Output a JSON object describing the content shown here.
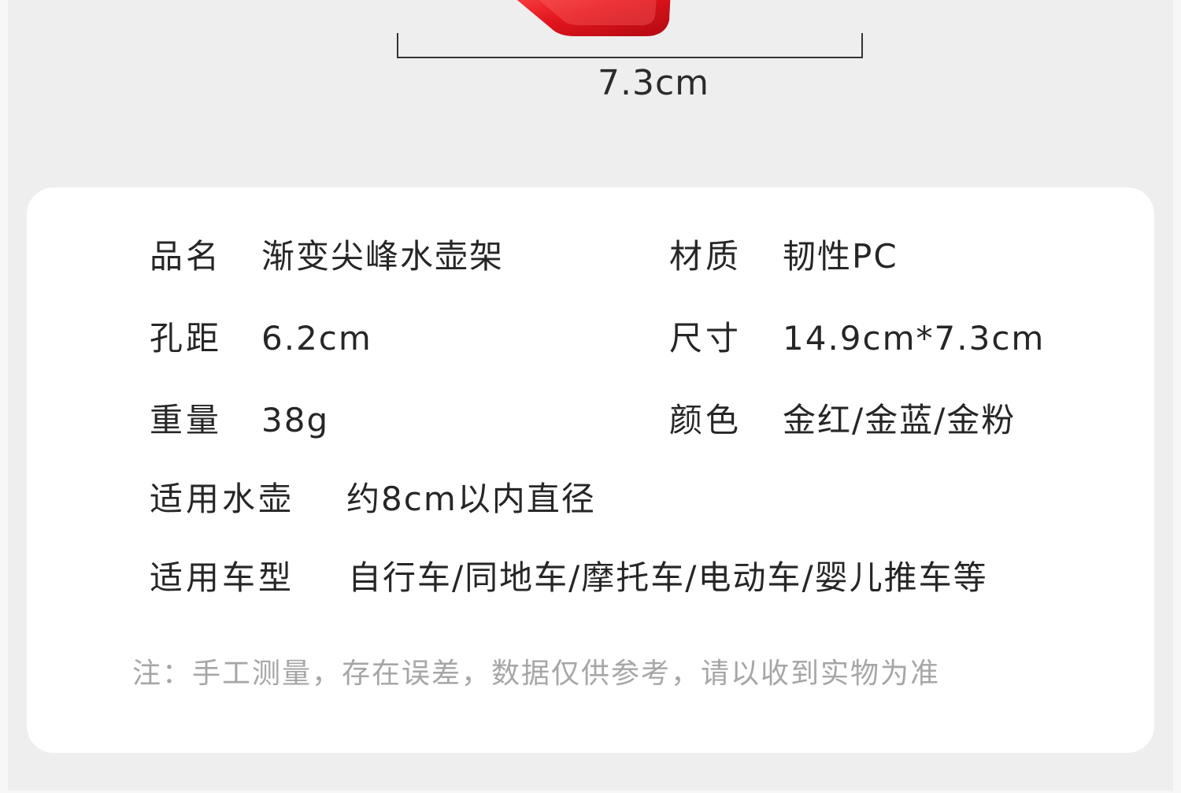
{
  "dimension": {
    "width_label": "7.3cm"
  },
  "specs": {
    "left": [
      {
        "label": "品名",
        "value": "渐变尖峰水壶架"
      },
      {
        "label": "孔距",
        "value": "6.2cm"
      },
      {
        "label": "重量",
        "value": "38g"
      }
    ],
    "right": [
      {
        "label": "材质",
        "value": "韧性PC"
      },
      {
        "label": "尺寸",
        "value": "14.9cm*7.3cm"
      },
      {
        "label": "颜色",
        "value": "金红/金蓝/金粉"
      }
    ],
    "wide": [
      {
        "label": "适用水壶",
        "value": "约8cm以内直径"
      },
      {
        "label": "适用车型",
        "value": "自行车/同地车/摩托车/电动车/婴儿推车等"
      }
    ]
  },
  "note": "注：手工测量，存在误差，数据仅供参考，请以收到实物为准",
  "colors": {
    "product_red": "#e0141c",
    "card_bg": "#ffffff",
    "page_bg": "#efeeee",
    "note_text": "#a6a6a6"
  }
}
